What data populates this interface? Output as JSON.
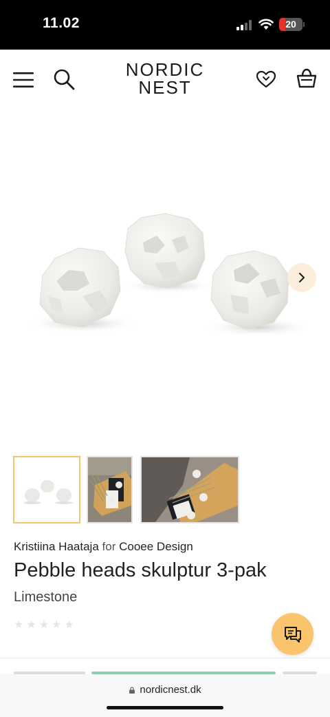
{
  "status": {
    "time": "11.02",
    "battery": "20"
  },
  "header": {
    "logo_line1": "NORDIC",
    "logo_line2": "NEST"
  },
  "product": {
    "designer": "Kristiina Haataja",
    "for_word": "for",
    "brand": "Cooee Design",
    "title": "Pebble heads skulptur 3-pak",
    "variant": "Limestone",
    "rating_stars": 0,
    "rating_max": 5
  },
  "gallery": {
    "thumbnail_count": 3,
    "active_index": 0
  },
  "browser": {
    "url": "nordicnest.dk"
  },
  "colors": {
    "accent": "#f9c46c",
    "active_border": "#f2c46f",
    "next_bg": "#fbeedd"
  },
  "icons": [
    "menu-icon",
    "search-icon",
    "wishlist-heart-icon",
    "basket-icon",
    "chevron-right-icon",
    "chat-icon",
    "lock-icon"
  ]
}
